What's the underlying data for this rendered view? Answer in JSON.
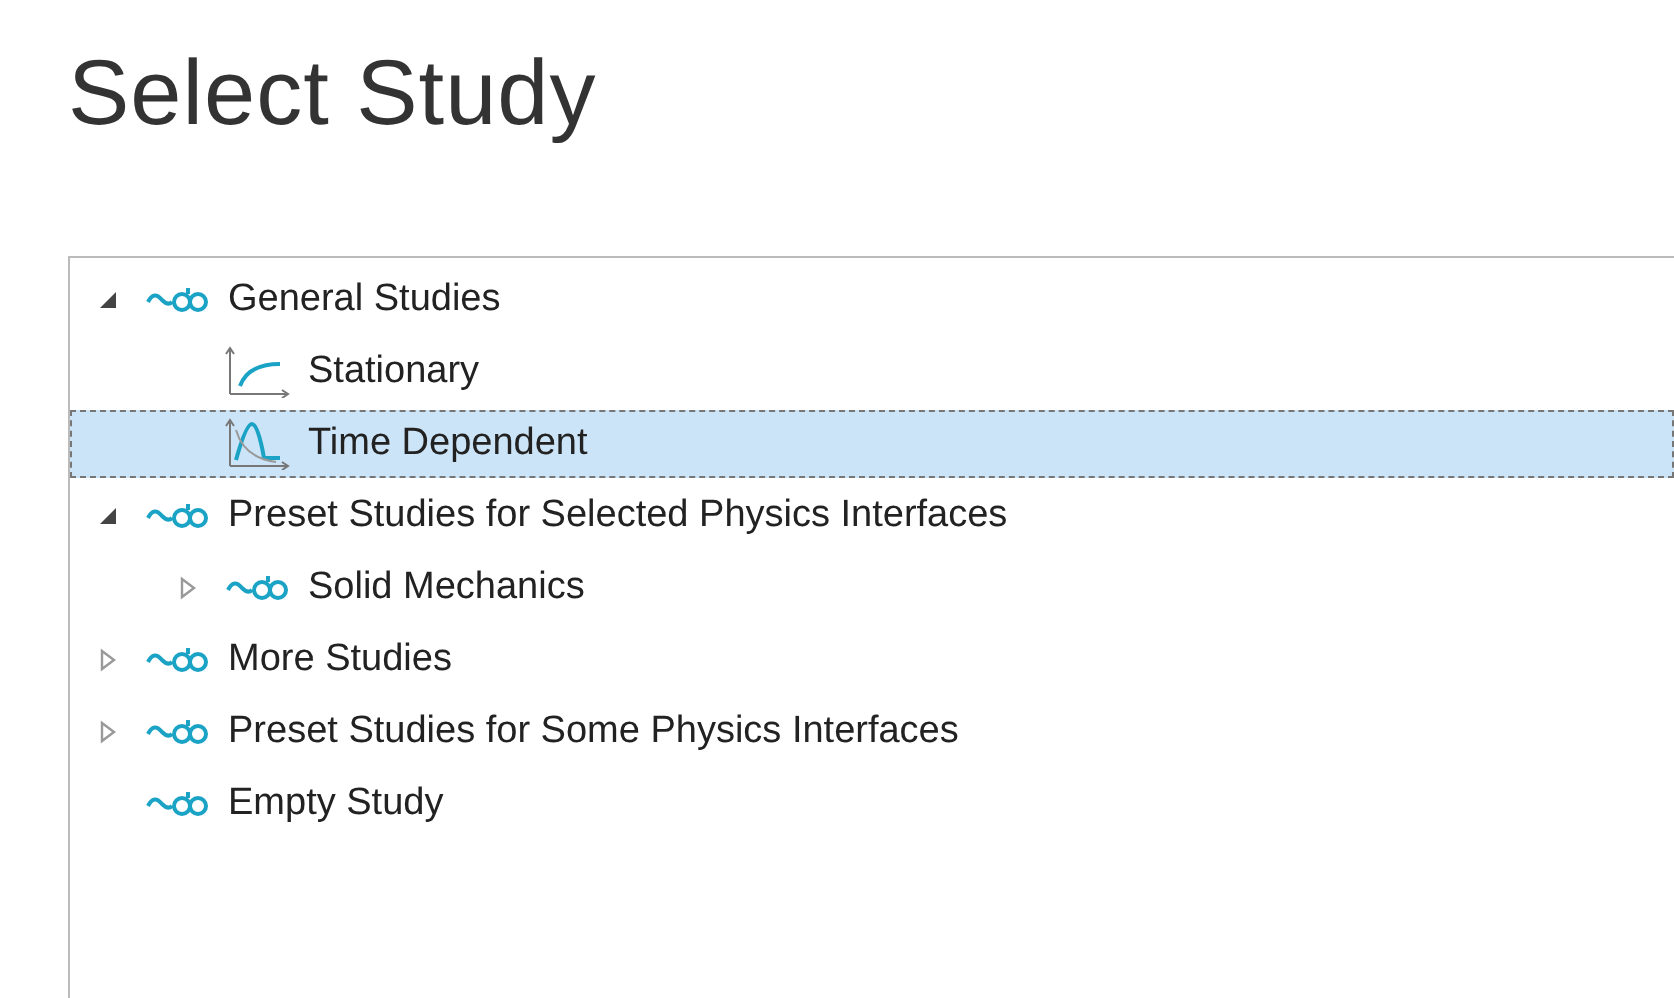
{
  "title": "Select Study",
  "tree": [
    {
      "label": "General Studies",
      "kind": "study",
      "expanded": true,
      "selected": false,
      "children": [
        {
          "label": "Stationary",
          "kind": "stationary",
          "selected": false
        },
        {
          "label": "Time Dependent",
          "kind": "time",
          "selected": true
        }
      ]
    },
    {
      "label": "Preset Studies for Selected Physics Interfaces",
      "kind": "study",
      "expanded": true,
      "selected": false,
      "children": [
        {
          "label": "Solid Mechanics",
          "kind": "study",
          "expanded": false,
          "selected": false
        }
      ]
    },
    {
      "label": "More Studies",
      "kind": "study",
      "expanded": false,
      "selected": false
    },
    {
      "label": "Preset Studies for Some Physics Interfaces",
      "kind": "study",
      "expanded": false,
      "selected": false
    },
    {
      "label": "Empty Study",
      "kind": "study",
      "selected": false
    }
  ]
}
